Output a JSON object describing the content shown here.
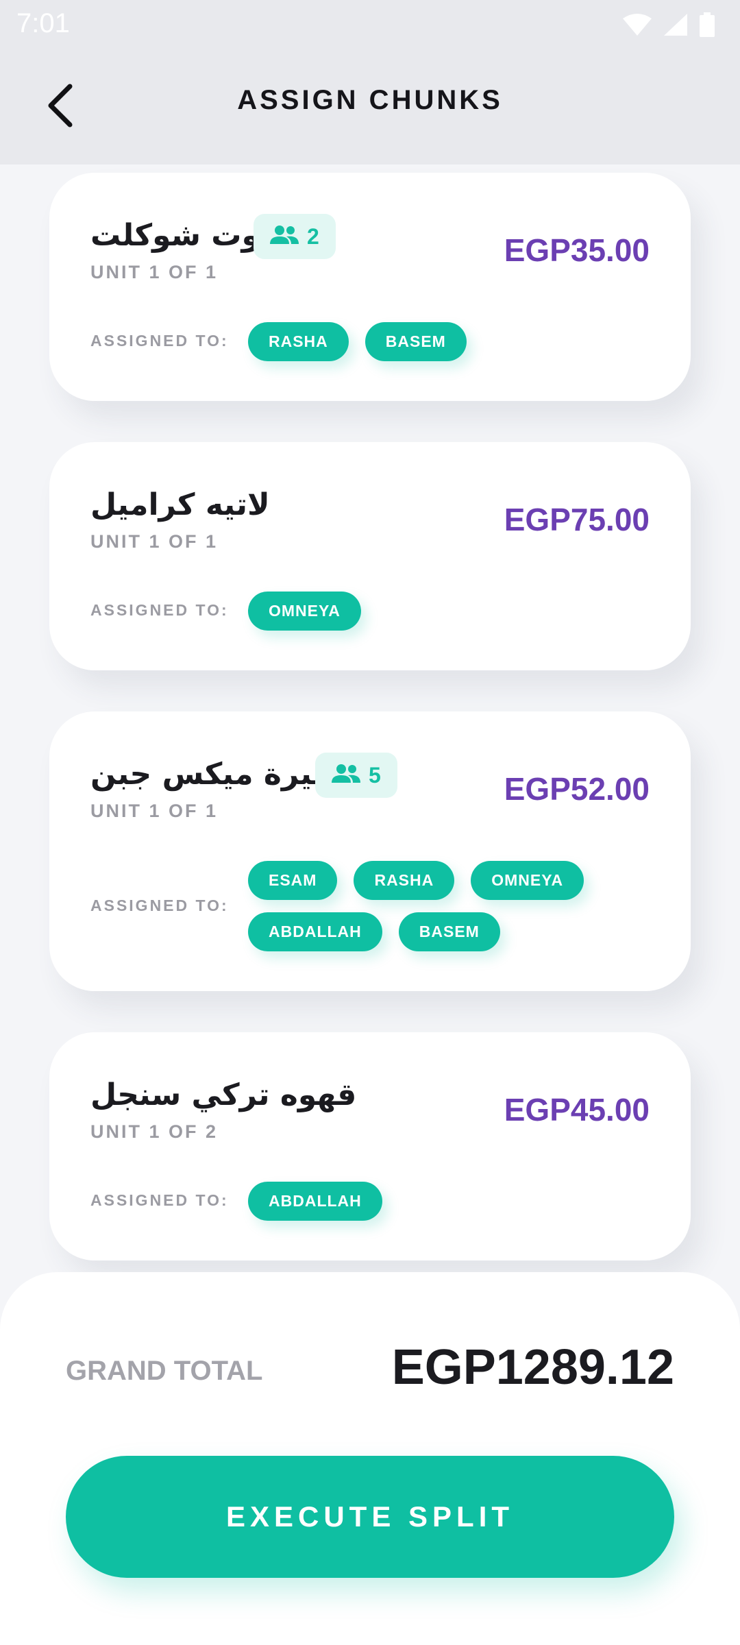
{
  "status_bar": {
    "time": "7:01",
    "icons": [
      "wifi-icon",
      "cellular-signal-icon",
      "battery-icon"
    ]
  },
  "header": {
    "back_icon": "chevron-left-icon",
    "title": "ASSIGN CHUNKS"
  },
  "colors": {
    "accent_teal": "#0fbfa2",
    "price_purple": "#6b3fb2",
    "badge_bg": "#e2f7f3"
  },
  "items": [
    {
      "name": "هوت شوكلت",
      "split_count": "2",
      "unit": "UNIT 1 OF 1",
      "price": "EGP35.00",
      "assigned_label": "ASSIGNED TO:",
      "assignees": [
        "RASHA",
        "BASEM"
      ]
    },
    {
      "name": "لاتيه كراميل",
      "split_count": "",
      "unit": "UNIT 1 OF 1",
      "price": "EGP75.00",
      "assigned_label": "ASSIGNED TO:",
      "assignees": [
        "OMNEYA"
      ]
    },
    {
      "name": "فطيرة ميكس جبن",
      "split_count": "5",
      "unit": "UNIT 1 OF 1",
      "price": "EGP52.00",
      "assigned_label": "ASSIGNED TO:",
      "assignees": [
        "ESAM",
        "RASHA",
        "OMNEYA",
        "ABDALLAH",
        "BASEM"
      ]
    },
    {
      "name": "قهوه تركي سنجل",
      "split_count": "",
      "unit": "UNIT 1 OF 2",
      "price": "EGP45.00",
      "assigned_label": "ASSIGNED TO:",
      "assignees": [
        "ABDALLAH"
      ]
    }
  ],
  "footer": {
    "grand_total_label": "GRAND TOTAL",
    "grand_total_value": "EGP1289.12",
    "execute_label": "EXECUTE SPLIT"
  }
}
